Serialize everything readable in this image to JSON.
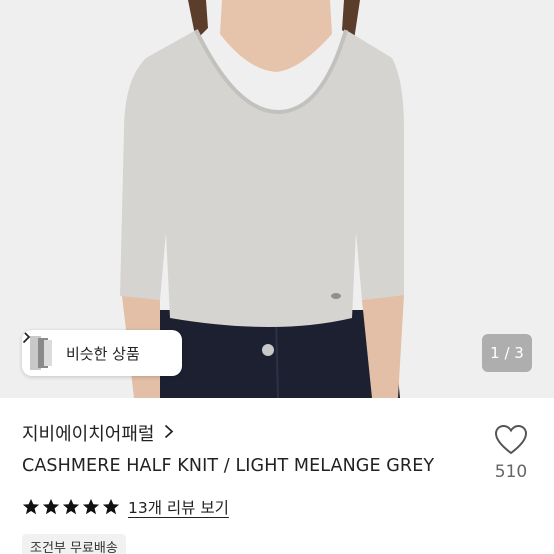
{
  "hero": {
    "similar_label": "비슷한 상품",
    "page_counter": "1 / 3"
  },
  "product": {
    "shop_name": "지비에이치어패럴",
    "title": "CASHMERE HALF KNIT / LIGHT MELANGE GREY",
    "likes": "510",
    "rating_stars": 5,
    "review_link": "13개 리뷰 보기",
    "shipping_badge": "조건부 무료배송"
  },
  "icons": {
    "shop_chevron": "chevron-right-icon",
    "like": "heart-icon",
    "star": "star-icon"
  },
  "colors": {
    "star": "#111111",
    "background": "#eeeeee"
  }
}
